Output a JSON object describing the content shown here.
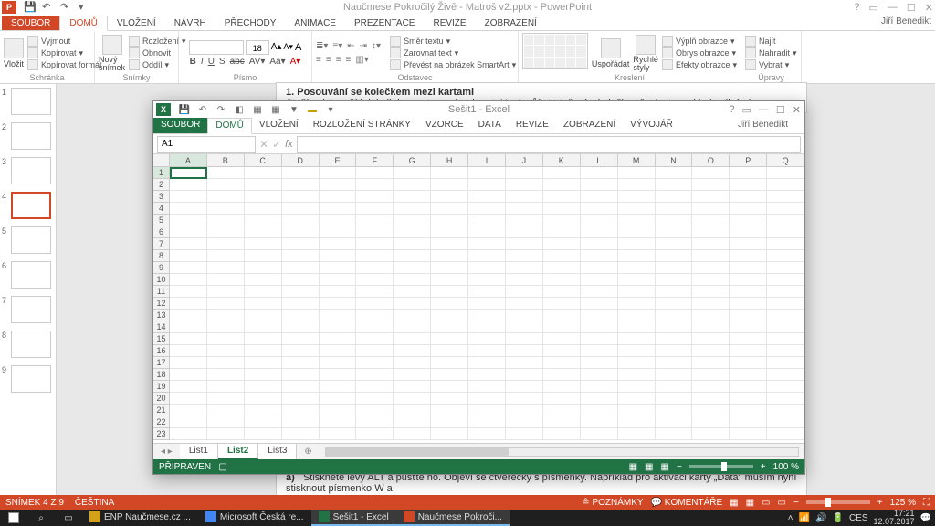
{
  "powerpoint": {
    "titlebar": {
      "title": "Naučmese Pokročilý Živě - Matroš v2.pptx - PowerPoint",
      "user": "Jiří Benedikt"
    },
    "tabs": {
      "file": "SOUBOR",
      "items": [
        "DOMŮ",
        "VLOŽENÍ",
        "NÁVRH",
        "PŘECHODY",
        "ANIMACE",
        "PREZENTACE",
        "REVIZE",
        "ZOBRAZENÍ"
      ],
      "active": "DOMŮ"
    },
    "ribbon": {
      "clipboard": {
        "title": "Schránka",
        "paste": "Vložit",
        "cut": "Vyjmout",
        "copy": "Kopírovat",
        "formatpainter": "Kopírovat formát"
      },
      "slides": {
        "title": "Snímky",
        "newslide": "Nový\nsnímek",
        "layout": "Rozložení",
        "reset": "Obnovit",
        "section": "Oddíl"
      },
      "font": {
        "title": "Písmo",
        "size": "18"
      },
      "paragraph": {
        "title": "Odstavec",
        "direction": "Směr textu",
        "align": "Zarovnat text",
        "smartart": "Převést na obrázek SmartArt"
      },
      "drawing": {
        "title": "Kreslení",
        "arrange": "Uspořádat",
        "quickstyles": "Rychlé\nstyly",
        "fill": "Výplň obrazce",
        "outline": "Obrys obrazce",
        "effects": "Efekty obrazce"
      },
      "editing": {
        "title": "Úpravy",
        "find": "Najít",
        "replace": "Nahradit",
        "select": "Vybrat"
      }
    },
    "thumbnails": [
      1,
      2,
      3,
      4,
      5,
      6,
      7,
      8,
      9
    ],
    "activeSlide": 4,
    "slideText": {
      "h": "1.    Posouvání se kolečkem mezi kartami",
      "p1": "Stačí najet myší kdekoli do prostoru pásu karet. Nyní můžete točením kolečka přepínat mezi jednotlivými",
      "h2b": "a)",
      "p2rest": "Stiskněte levý ALT a pusťte ho. Objeví se čtverečky s písmenky. Například pro aktivaci karty „Data\" musím nyní stisknout písmenko W a"
    },
    "status": {
      "slide": "SNÍMEK 4 Z 9",
      "lang": "ČEŠTINA",
      "notes": "POZNÁMKY",
      "comments": "KOMENTÁŘE",
      "zoom": "125 %"
    }
  },
  "excel": {
    "titlebar": {
      "title": "Sešit1 - Excel"
    },
    "tabs": {
      "file": "SOUBOR",
      "items": [
        "DOMŮ",
        "VLOŽENÍ",
        "ROZLOŽENÍ STRÁNKY",
        "VZORCE",
        "DATA",
        "REVIZE",
        "ZOBRAZENÍ",
        "VÝVOJÁŘ"
      ],
      "active": "DOMŮ"
    },
    "user": "Jiří Benedikt",
    "namebox": "A1",
    "columns": [
      "A",
      "B",
      "C",
      "D",
      "E",
      "F",
      "G",
      "H",
      "I",
      "J",
      "K",
      "L",
      "M",
      "N",
      "O",
      "P",
      "Q"
    ],
    "rows": [
      1,
      2,
      3,
      4,
      5,
      6,
      7,
      8,
      9,
      10,
      11,
      12,
      13,
      14,
      15,
      16,
      17,
      18,
      19,
      20,
      21,
      22,
      23
    ],
    "activeCell": "A1",
    "sheets": [
      "List1",
      "List2",
      "List3"
    ],
    "activeSheet": "List2",
    "status": {
      "ready": "PŘIPRAVEN",
      "zoom": "100 %"
    }
  },
  "taskbar": {
    "tasks": [
      {
        "label": "ENP Naučmese.cz ...",
        "color": "#d4a017"
      },
      {
        "label": "Microsoft Česká re...",
        "color": "#4285f4"
      },
      {
        "label": "Sešit1 - Excel",
        "color": "#217346"
      },
      {
        "label": "Naučmese Pokroči...",
        "color": "#d24726"
      }
    ],
    "tray": {
      "lang": "CES",
      "time": "17:21",
      "date": "12.07.2017"
    }
  }
}
